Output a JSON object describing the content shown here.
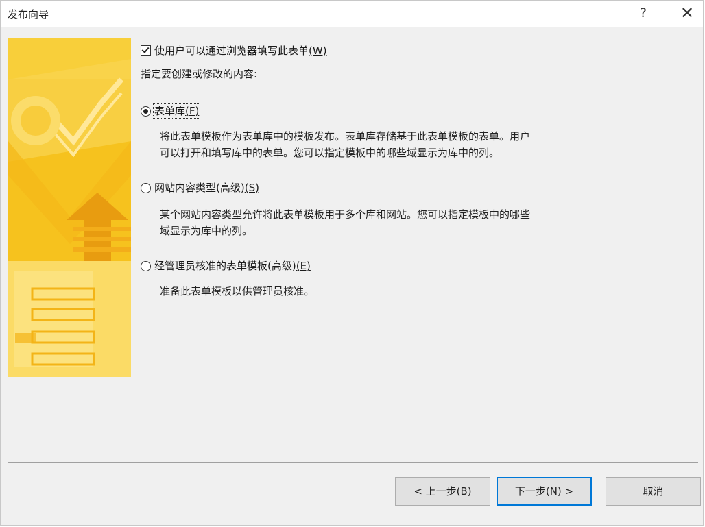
{
  "window": {
    "title": "发布向导",
    "help_label": "?",
    "close_label": "✕"
  },
  "options": {
    "browser_checkbox": {
      "checked": true,
      "label": "使用户可以通过浏览器填写此表单",
      "accesskey": "(W)"
    },
    "prompt": "指定要创建或修改的内容:",
    "choices": [
      {
        "selected": true,
        "label": "表单库",
        "accesskey": "(F)",
        "desc_line1": "将此表单模板作为表单库中的模板发布。表单库存储基于此表单模板的表单。用户",
        "desc_line2": "可以打开和填写库中的表单。您可以指定模板中的哪些域显示为库中的列。"
      },
      {
        "selected": false,
        "label": "网站内容类型(高级)",
        "accesskey": "(S)",
        "desc_line1": "某个网站内容类型允许将此表单模板用于多个库和网站。您可以指定模板中的哪些",
        "desc_line2": "域显示为库中的列。"
      },
      {
        "selected": false,
        "label": "经管理员核准的表单模板(高级)",
        "accesskey": "(E)",
        "desc_line1": "准备此表单模板以供管理员核准。"
      }
    ]
  },
  "buttons": {
    "prev": "< 上一步(B)",
    "next": "下一步(N) >",
    "cancel": "取消"
  },
  "colors": {
    "banner": "#f6c21e",
    "dialog_bg": "#f0f0f0",
    "focus_border": "#0078d7"
  }
}
